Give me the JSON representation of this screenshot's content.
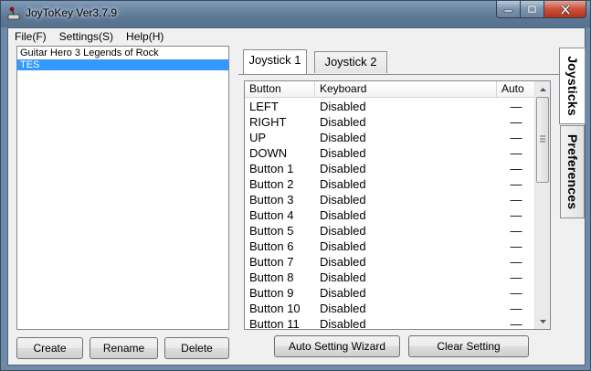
{
  "window": {
    "title": "JoyToKey Ver3.7.9"
  },
  "menu": [
    "File(F)",
    "Settings(S)",
    "Help(H)"
  ],
  "configs": [
    {
      "name": "Guitar Hero 3 Legends of Rock",
      "selected": false
    },
    {
      "name": "TES",
      "selected": true
    }
  ],
  "buttons": {
    "create": "Create",
    "rename": "Rename",
    "delete": "Delete",
    "wizard": "Auto Setting Wizard",
    "clear": "Clear Setting"
  },
  "tabs": {
    "joystick1": "Joystick 1",
    "joystick2": "Joystick 2"
  },
  "side_tabs": {
    "joysticks": "Joysticks",
    "preferences": "Preferences"
  },
  "grid": {
    "headers": {
      "button": "Button",
      "keyboard": "Keyboard",
      "auto": "Auto"
    },
    "rows": [
      {
        "button": "LEFT",
        "keyboard": "Disabled",
        "auto": "—"
      },
      {
        "button": "RIGHT",
        "keyboard": "Disabled",
        "auto": "—"
      },
      {
        "button": "UP",
        "keyboard": "Disabled",
        "auto": "—"
      },
      {
        "button": "DOWN",
        "keyboard": "Disabled",
        "auto": "—"
      },
      {
        "button": "Button 1",
        "keyboard": "Disabled",
        "auto": "—"
      },
      {
        "button": "Button 2",
        "keyboard": "Disabled",
        "auto": "—"
      },
      {
        "button": "Button 3",
        "keyboard": "Disabled",
        "auto": "—"
      },
      {
        "button": "Button 4",
        "keyboard": "Disabled",
        "auto": "—"
      },
      {
        "button": "Button 5",
        "keyboard": "Disabled",
        "auto": "—"
      },
      {
        "button": "Button 6",
        "keyboard": "Disabled",
        "auto": "—"
      },
      {
        "button": "Button 7",
        "keyboard": "Disabled",
        "auto": "—"
      },
      {
        "button": "Button 8",
        "keyboard": "Disabled",
        "auto": "—"
      },
      {
        "button": "Button 9",
        "keyboard": "Disabled",
        "auto": "—"
      },
      {
        "button": "Button 10",
        "keyboard": "Disabled",
        "auto": "—"
      },
      {
        "button": "Button 11",
        "keyboard": "Disabled",
        "auto": "—"
      }
    ]
  },
  "colors": {
    "selection": "#3399ff",
    "title_bar": "#6f8aa6"
  }
}
